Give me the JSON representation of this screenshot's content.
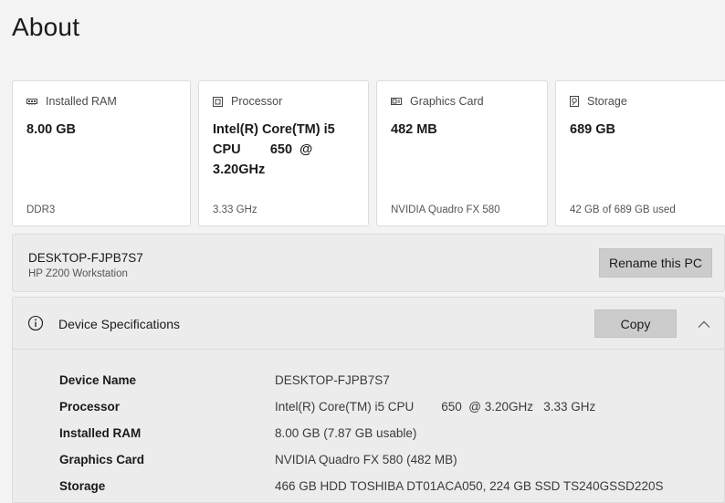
{
  "page": {
    "title": "About"
  },
  "cards": [
    {
      "icon": "ram-icon",
      "label": "Installed RAM",
      "value": "8.00 GB",
      "sub": "DDR3"
    },
    {
      "icon": "processor-icon",
      "label": "Processor",
      "value": "Intel(R) Core(TM) i5\nCPU        650  @\n3.20GHz",
      "sub": "3.33 GHz"
    },
    {
      "icon": "graphics-card-icon",
      "label": "Graphics Card",
      "value": "482 MB",
      "sub": "NVIDIA Quadro FX 580"
    },
    {
      "icon": "storage-icon",
      "label": "Storage",
      "value": "689 GB",
      "sub": "42 GB of 689 GB used"
    }
  ],
  "device": {
    "name": "DESKTOP-FJPB7S7",
    "model": "HP Z200 Workstation",
    "rename_label": "Rename this PC"
  },
  "specs": {
    "title": "Device Specifications",
    "copy_label": "Copy",
    "rows": [
      {
        "key": "Device Name",
        "value": "DESKTOP-FJPB7S7"
      },
      {
        "key": "Processor",
        "value": "Intel(R) Core(TM) i5 CPU        650  @ 3.20GHz   3.33 GHz"
      },
      {
        "key": "Installed RAM",
        "value": "8.00 GB (7.87 GB usable)"
      },
      {
        "key": "Graphics Card",
        "value": "NVIDIA Quadro FX 580 (482 MB)"
      },
      {
        "key": "Storage",
        "value": "466 GB HDD TOSHIBA DT01ACA050, 224 GB SSD TS240GSSD220S"
      }
    ]
  },
  "colors": {
    "background": "#f3f3f3",
    "card": "#ffffff",
    "panel": "#ececec",
    "button": "#cccccc"
  }
}
